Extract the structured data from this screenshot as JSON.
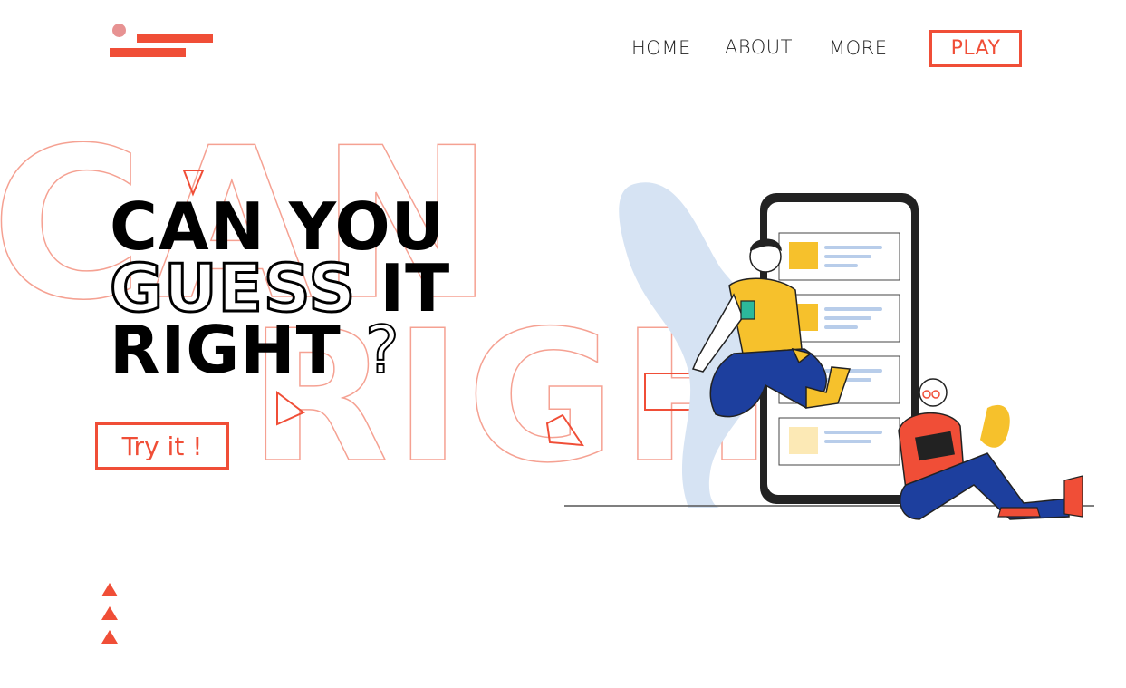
{
  "logo": {
    "name": "logo",
    "accent": "#f04e37",
    "dot_color": "#e79292"
  },
  "nav": {
    "items": [
      {
        "label": "HOME"
      },
      {
        "label": "ABOUT"
      },
      {
        "label": "MORE"
      }
    ],
    "cta_label": "PLAY"
  },
  "hero": {
    "line1": "CAN YOU",
    "line2_outline": "GUESS",
    "line2_solid": "IT",
    "line3_solid": "RIGHT",
    "line3_q": "?",
    "background_outline_words": [
      "CAN",
      "RIGH"
    ],
    "try_button_label": "Try it !"
  },
  "icons": {
    "scroll_arrows": [
      "triangle-up-icon",
      "triangle-up-icon",
      "triangle-up-icon"
    ]
  },
  "colors": {
    "accent": "#f04e37",
    "outline_text": "#f5a192",
    "text": "#000000"
  }
}
